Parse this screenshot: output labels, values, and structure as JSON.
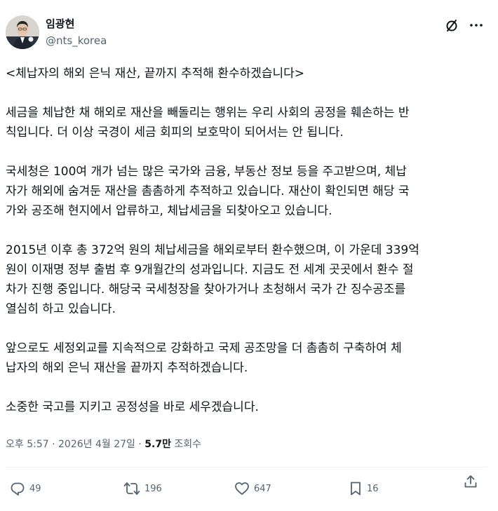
{
  "author": {
    "display_name": "임광현",
    "handle": "@nts_korea",
    "avatar_icon": "user-avatar"
  },
  "header_icons": {
    "grok": "grok-slash-circle-icon",
    "more": "more-dots-icon"
  },
  "tweet": {
    "paragraphs": [
      "<체납자의 해외 은닉 재산, 끝까지 추적해 환수하겠습니다>",
      "세금을 체납한 채 해외로 재산을 빼돌리는 행위는 우리 사회의 공정을 훼손하는 반\n칙입니다. 더 이상 국경이 세금 회피의 보호막이 되어서는 안 됩니다.",
      "국세청은 100여 개가 넘는 많은 국가와 금융, 부동산 정보 등을 주고받으며, 체납\n자가 해외에 숨겨둔 재산을 촘촘하게 추적하고 있습니다. 재산이 확인되면 해당 국\n가와 공조해 현지에서 압류하고, 체납세금을 되찾아오고 있습니다.",
      "2015년 이후 총 372억 원의 체납세금을 해외로부터 환수했으며, 이 가운데 339억\n원이 이재명 정부 출범 후 9개월간의 성과입니다. 지금도 전 세계 곳곳에서 환수 절\n차가 진행 중입니다. 해당국 국세청장을 찾아가거나 초청해서 국가 간 징수공조를\n열심히 하고 있습니다.",
      "앞으로도 세정외교를 지속적으로 강화하고 국제 공조망을 더 촘촘히 구축하여 체\n납자의 해외 은닉 재산을 끝까지 추적하겠습니다.",
      "소중한 국고를 지키고 공정성을 바로 세우겠습니다."
    ]
  },
  "meta": {
    "time": "오후 5:57",
    "separator": " · ",
    "date": "2026년 4월 27일",
    "views_count": "5.7만",
    "views_label": " 조회수"
  },
  "actions": {
    "reply": {
      "icon": "reply-icon",
      "count": "49"
    },
    "retweet": {
      "icon": "retweet-icon",
      "count": "196"
    },
    "like": {
      "icon": "like-heart-icon",
      "count": "647"
    },
    "bookmark": {
      "icon": "bookmark-icon",
      "count": "16"
    },
    "share": {
      "icon": "share-upload-icon"
    }
  },
  "colors": {
    "text": "#0f1419",
    "secondary": "#536471",
    "divider": "#eff3f4"
  }
}
